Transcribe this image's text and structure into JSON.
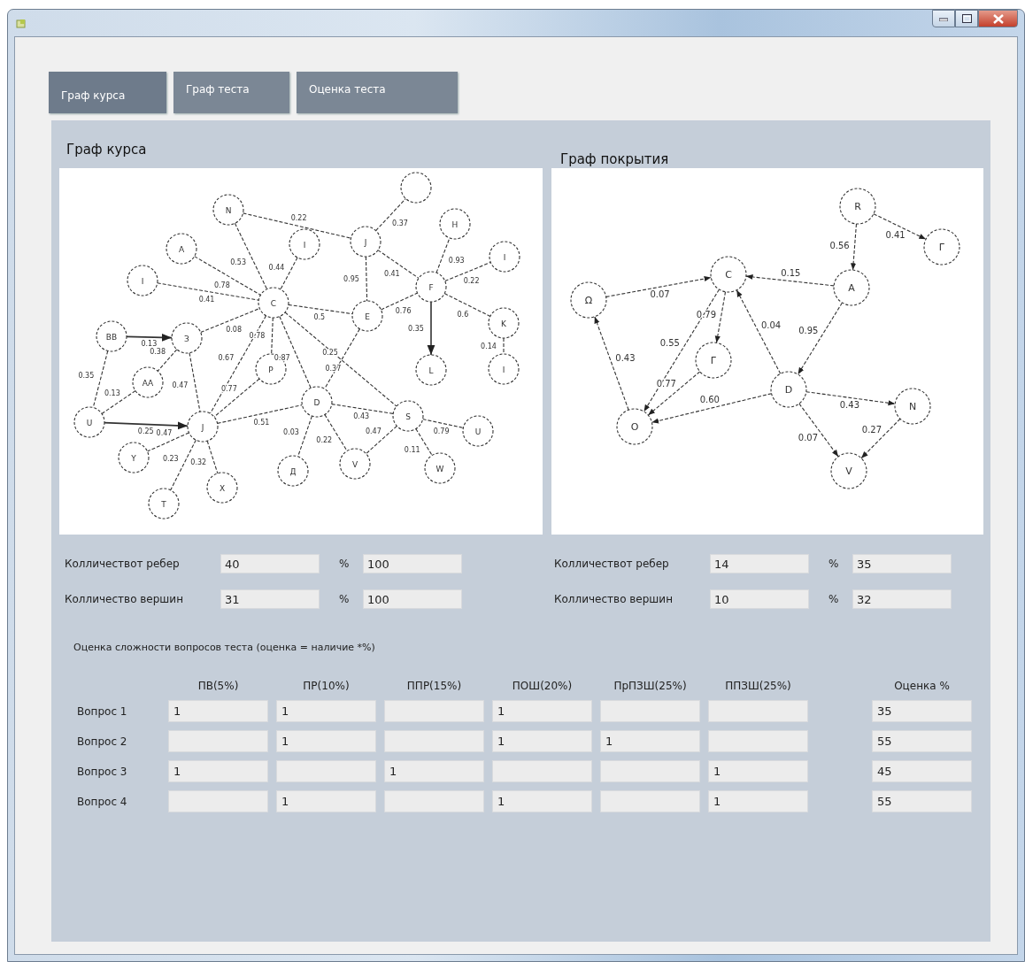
{
  "tabs": [
    {
      "label": "Граф курса",
      "selected": true
    },
    {
      "label": "Граф теста",
      "selected": false
    },
    {
      "label": "Оценка теста",
      "selected": false
    }
  ],
  "graphs": [
    {
      "title": "Граф курса",
      "directed": false,
      "nodes": [
        {
          "kind": "labeled",
          "label": "N"
        },
        {
          "kind": "labeled",
          "label": "A"
        },
        {
          "kind": "labeled",
          "label": "I"
        },
        {
          "kind": "labeled",
          "label": "C"
        },
        {
          "kind": "labeled",
          "label": "BB"
        },
        {
          "kind": "labeled",
          "label": "З"
        },
        {
          "kind": "labeled",
          "label": "AA"
        },
        {
          "kind": "labeled",
          "label": "U"
        },
        {
          "kind": "labeled",
          "label": "J"
        },
        {
          "kind": "labeled",
          "label": "Y"
        },
        {
          "kind": "labeled",
          "label": "X"
        },
        {
          "kind": "labeled",
          "label": "T"
        },
        {
          "kind": "labeled",
          "label": "P"
        },
        {
          "kind": "labeled",
          "label": "D"
        },
        {
          "kind": "labeled",
          "label": "Д"
        },
        {
          "kind": "labeled",
          "label": "V"
        },
        {
          "kind": "labeled",
          "label": "S"
        },
        {
          "kind": "labeled",
          "label": "W"
        },
        {
          "kind": "labeled",
          "label": "U"
        },
        {
          "kind": "labeled",
          "label": "E"
        },
        {
          "kind": "labeled",
          "label": "F"
        },
        {
          "kind": "labeled",
          "label": "L"
        },
        {
          "kind": "labeled",
          "label": "K"
        },
        {
          "kind": "labeled",
          "label": "I"
        },
        {
          "kind": "labeled",
          "label": "I"
        },
        {
          "kind": "labeled",
          "label": "H"
        },
        {
          "kind": "blank"
        },
        {
          "kind": "labeled",
          "label": "J"
        },
        {
          "kind": "labeled",
          "label": "I"
        }
      ],
      "edges": [
        {
          "weight": "0.22",
          "kind": "dashed"
        },
        {
          "weight": "0.53",
          "kind": "dashed"
        },
        {
          "weight": "0.78",
          "kind": "dashed"
        },
        {
          "weight": "0.41",
          "kind": "dashed"
        },
        {
          "weight": "0.44",
          "kind": "dashed"
        },
        {
          "weight": "0.08",
          "kind": "dashed"
        },
        {
          "weight": "0.13",
          "kind": "solid"
        },
        {
          "weight": "0.35",
          "kind": "dashed"
        },
        {
          "weight": "0.38",
          "kind": "dashed"
        },
        {
          "weight": "0.13",
          "kind": "dashed"
        },
        {
          "weight": "0.47",
          "kind": "dashed"
        },
        {
          "weight": "0.25",
          "kind": "solid"
        },
        {
          "weight": "0.67",
          "kind": "dashed"
        },
        {
          "weight": "0.77",
          "kind": "dashed"
        },
        {
          "weight": "0.51",
          "kind": "dashed"
        },
        {
          "weight": "0.47",
          "kind": "dashed"
        },
        {
          "weight": "0.23",
          "kind": "dashed"
        },
        {
          "weight": "0.32",
          "kind": "dashed"
        },
        {
          "weight": "0.78",
          "kind": "dashed"
        },
        {
          "weight": "0.87",
          "kind": "dashed"
        },
        {
          "weight": "0.5",
          "kind": "dashed"
        },
        {
          "weight": "0.37",
          "kind": "dashed"
        },
        {
          "weight": "0.25",
          "kind": "dashed"
        },
        {
          "weight": "0.43",
          "kind": "dashed"
        },
        {
          "weight": "0.03",
          "kind": "dashed"
        },
        {
          "weight": "0.22",
          "kind": "dashed"
        },
        {
          "weight": "0.47",
          "kind": "dashed"
        },
        {
          "weight": "0.11",
          "kind": "dashed"
        },
        {
          "weight": "0.79",
          "kind": "dashed"
        },
        {
          "weight": "0.76",
          "kind": "dashed"
        },
        {
          "weight": "0.41",
          "kind": "dashed"
        },
        {
          "weight": "0.37",
          "kind": "dashed"
        },
        {
          "weight": "0.93",
          "kind": "dashed"
        },
        {
          "weight": "0.22",
          "kind": "dashed"
        },
        {
          "weight": "0.6",
          "kind": "dashed"
        },
        {
          "weight": "0.35",
          "kind": "solid"
        },
        {
          "weight": "0.14",
          "kind": "dashed"
        },
        {
          "weight": "0.95",
          "kind": "dashed"
        }
      ],
      "stats": [
        {
          "label": "Колличествот ребер",
          "count": "40",
          "percent_sign": "%",
          "percent": "100"
        },
        {
          "label": "Колличество вершин",
          "count": "31",
          "percent_sign": "%",
          "percent": "100"
        }
      ]
    },
    {
      "title": "Граф покрытия",
      "directed": true,
      "nodes": [
        {
          "kind": "labeled",
          "label": "R"
        },
        {
          "kind": "labeled",
          "label": "Г"
        },
        {
          "kind": "labeled",
          "label": "A"
        },
        {
          "kind": "labeled",
          "label": "C"
        },
        {
          "kind": "labeled",
          "label": "Ω"
        },
        {
          "kind": "labeled",
          "label": "Г"
        },
        {
          "kind": "labeled",
          "label": "O"
        },
        {
          "kind": "labeled",
          "label": "D"
        },
        {
          "kind": "labeled",
          "label": "N"
        },
        {
          "kind": "labeled",
          "label": "V"
        }
      ],
      "edges": [
        {
          "weight": "0.56",
          "kind": "dashed"
        },
        {
          "weight": "0.41",
          "kind": "dashed"
        },
        {
          "weight": "0.15",
          "kind": "dashed"
        },
        {
          "weight": "0.95",
          "kind": "dashed"
        },
        {
          "weight": "0.07",
          "kind": "dashed"
        },
        {
          "weight": "0.79",
          "kind": "dashed"
        },
        {
          "weight": "0.55",
          "kind": "dashed"
        },
        {
          "weight": "0.77",
          "kind": "dashed"
        },
        {
          "weight": "0.04",
          "kind": "dashed"
        },
        {
          "weight": "0.60",
          "kind": "dashed"
        },
        {
          "weight": "0.43",
          "kind": "dashed"
        },
        {
          "weight": "0.43",
          "kind": "dashed"
        },
        {
          "weight": "0.07",
          "kind": "dashed"
        },
        {
          "weight": "0.27",
          "kind": "dashed"
        }
      ],
      "stats": [
        {
          "label": "Колличествот ребер",
          "count": "14",
          "percent_sign": "%",
          "percent": "35"
        },
        {
          "label": "Колличество вершин",
          "count": "10",
          "percent_sign": "%",
          "percent": "32"
        }
      ]
    }
  ],
  "score_table": {
    "caption": "Оценка сложности вопросов теста (оценка = наличие *%)",
    "columns": [
      "ПВ(5%)",
      "ПР(10%)",
      "ППР(15%)",
      "ПОШ(20%)",
      "ПрПЗШ(25%)",
      "ППЗШ(25%)"
    ],
    "score_column": "Оценка %",
    "rows": [
      {
        "label": "Вопрос 1",
        "cells": [
          "1",
          "1",
          null,
          "1",
          null,
          null
        ],
        "score": "35"
      },
      {
        "label": "Вопрос 2",
        "cells": [
          null,
          "1",
          null,
          "1",
          "1",
          null
        ],
        "score": "55"
      },
      {
        "label": "Вопрос 3",
        "cells": [
          "1",
          null,
          "1",
          null,
          null,
          "1"
        ],
        "score": "45"
      },
      {
        "label": "Вопрос 4",
        "cells": [
          null,
          "1",
          null,
          "1",
          null,
          "1"
        ],
        "score": "55"
      }
    ]
  }
}
